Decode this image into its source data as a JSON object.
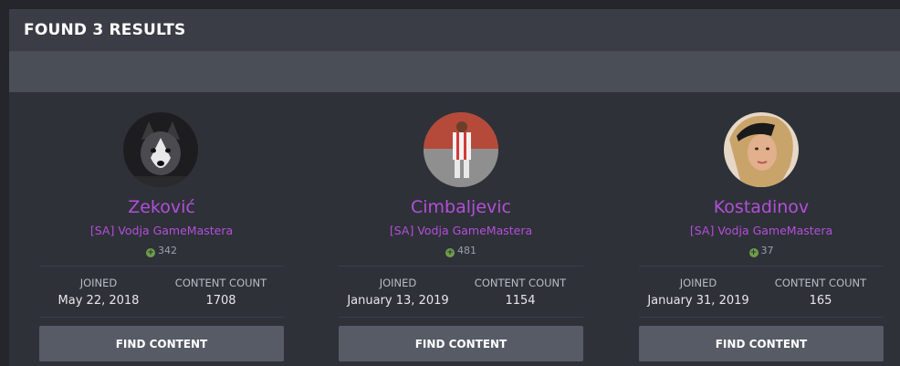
{
  "header": {
    "title": "FOUND 3 RESULTS"
  },
  "labels": {
    "joined": "JOINED",
    "content_count": "CONTENT COUNT",
    "find_content": "FIND CONTENT"
  },
  "colors": {
    "name": "#b34fd9",
    "rep_icon": "#6f9e4a",
    "button": "#575b66"
  },
  "members": [
    {
      "name": "Zeković",
      "role": "[SA] Vodja GameMastera",
      "reputation": "342",
      "joined": "May 22, 2018",
      "content_count": "1708",
      "avatar_icon": "husky-avatar"
    },
    {
      "name": "Cimbaljevic",
      "role": "[SA] Vodja GameMastera",
      "reputation": "481",
      "joined": "January 13, 2019",
      "content_count": "1154",
      "avatar_icon": "football-player-avatar"
    },
    {
      "name": "Kostadinov",
      "role": "[SA] Vodja GameMastera",
      "reputation": "37",
      "joined": "January 31, 2019",
      "content_count": "165",
      "avatar_icon": "woman-avatar"
    }
  ]
}
